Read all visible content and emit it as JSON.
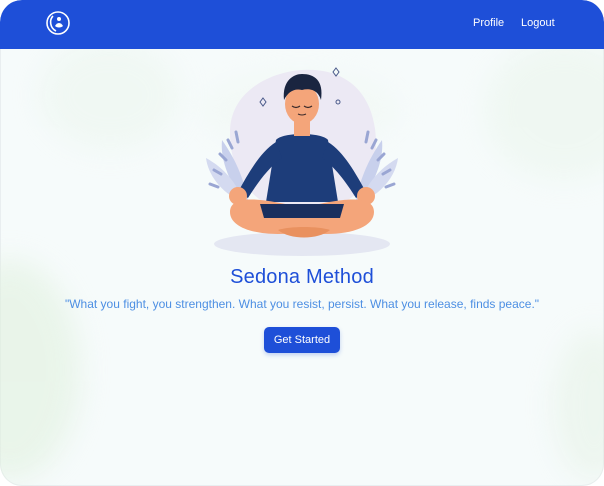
{
  "nav": {
    "logo_icon": "meditation-logo-icon",
    "items": [
      {
        "label": "Profile"
      },
      {
        "label": "Logout"
      }
    ]
  },
  "hero": {
    "illustration": "meditating-person-illustration",
    "title": "Sedona Method",
    "quote": "\"What you fight, you strengthen. What you resist, persist. What you release, finds peace.\"",
    "cta_label": "Get Started"
  },
  "colors": {
    "primary": "#1e4fd8",
    "quote_text": "#4d8fe3",
    "background": "#f6fbfb"
  }
}
